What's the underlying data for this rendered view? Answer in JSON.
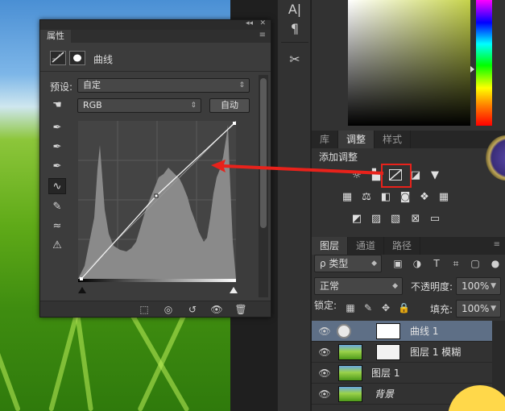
{
  "tool_strip": {
    "text_tool_icon": "A|",
    "paragraph_icon": "¶",
    "tools_icon": "✂"
  },
  "properties": {
    "tab_label": "属性",
    "header_title": "曲线",
    "preset_label": "预设:",
    "preset_value": "自定",
    "channel_value": "RGB",
    "auto_button": "自动"
  },
  "adjustments": {
    "tabs": [
      "库",
      "调整",
      "样式"
    ],
    "title": "添加调整"
  },
  "layers": {
    "tabs": [
      "图层",
      "通道",
      "路径"
    ],
    "filter_kind": "ρ 类型",
    "blend_mode": "正常",
    "opacity_label": "不透明度:",
    "opacity_value": "100%",
    "lock_label": "锁定:",
    "fill_label": "填充:",
    "fill_value": "100%",
    "items": [
      {
        "name": "曲线 1"
      },
      {
        "name": "图层 1 模糊"
      },
      {
        "name": "图层 1"
      },
      {
        "name": "背景"
      }
    ]
  },
  "colors": {
    "highlight": "#e8221b",
    "selected_layer": "#5e6f86"
  }
}
